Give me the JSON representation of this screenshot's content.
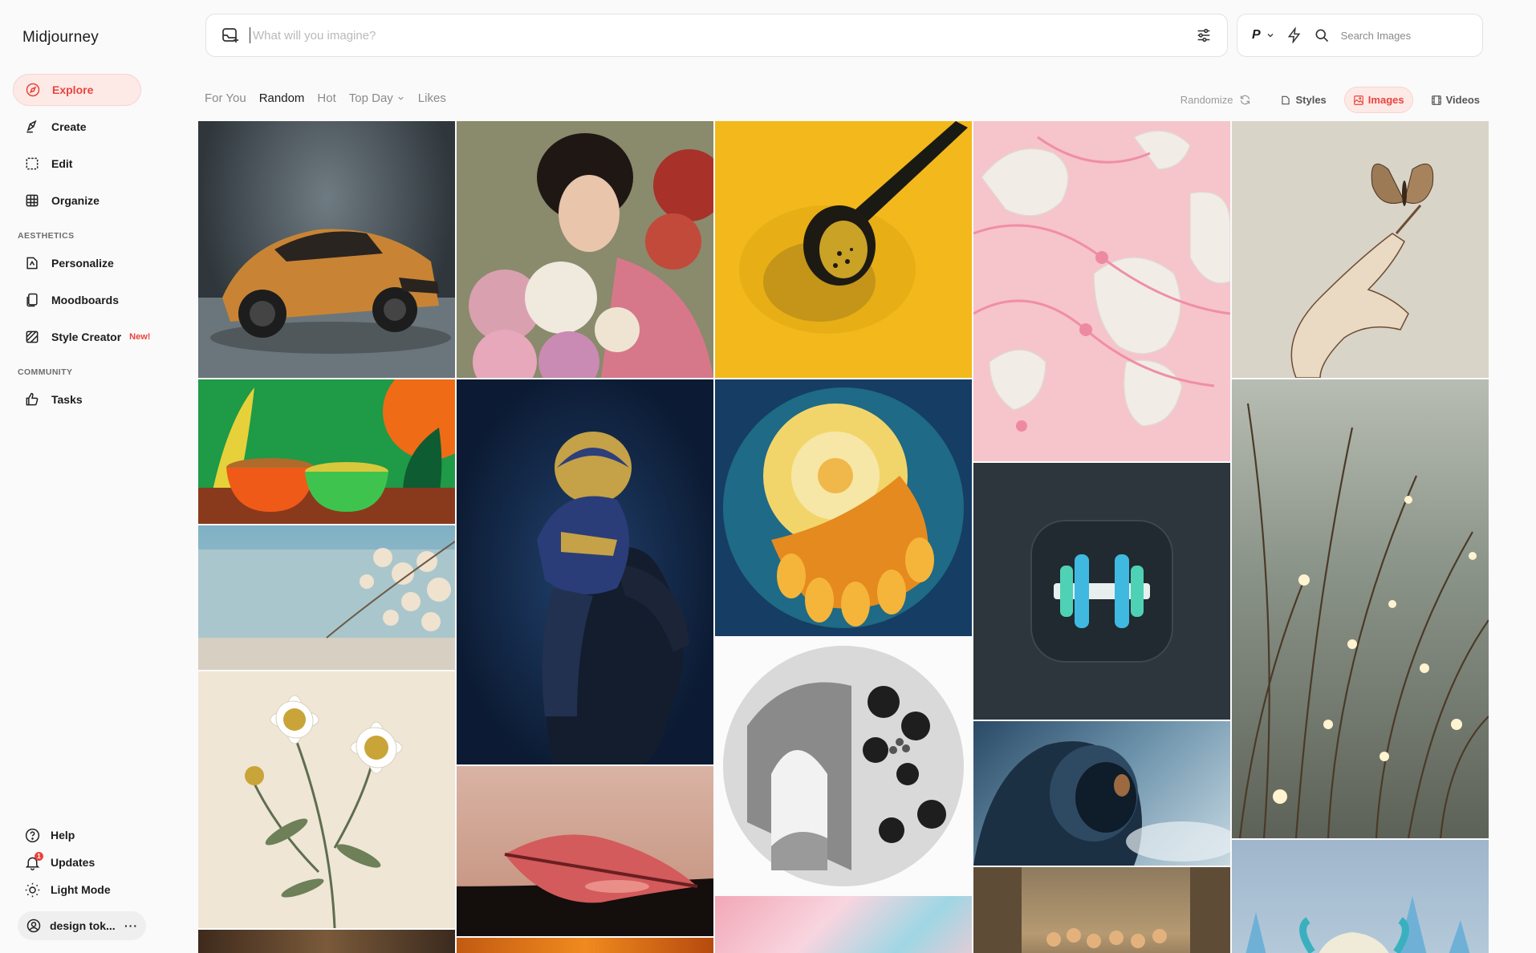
{
  "sidebar": {
    "brand": "Midjourney",
    "nav": [
      {
        "label": "Explore",
        "icon": "compass-icon"
      },
      {
        "label": "Create",
        "icon": "brush-icon"
      },
      {
        "label": "Edit",
        "icon": "edit-icon"
      },
      {
        "label": "Organize",
        "icon": "grid-icon"
      }
    ],
    "aesthetics_title": "AESTHETICS",
    "aesthetics": [
      {
        "label": "Personalize",
        "icon": "personalize-icon"
      },
      {
        "label": "Moodboards",
        "icon": "moodboard-icon"
      },
      {
        "label": "Style Creator",
        "icon": "style-creator-icon",
        "badge": "New!"
      }
    ],
    "community_title": "COMMUNITY",
    "community": [
      {
        "label": "Tasks",
        "icon": "thumbs-up-icon"
      }
    ],
    "bottom": [
      {
        "label": "Help",
        "icon": "help-icon"
      },
      {
        "label": "Updates",
        "icon": "bell-icon",
        "badge": "1"
      },
      {
        "label": "Light Mode",
        "icon": "sun-icon"
      }
    ],
    "user": "design tok..."
  },
  "prompt": {
    "placeholder": "What will you imagine?"
  },
  "search": {
    "mode": "P",
    "placeholder": "Search Images"
  },
  "filters": [
    "For You",
    "Random",
    "Hot",
    "Top Day",
    "Likes"
  ],
  "active_filter": "Random",
  "controls": {
    "randomize": "Randomize",
    "styles": "Styles",
    "images": "Images",
    "videos": "Videos"
  },
  "colors": {
    "accent": "#e8453c",
    "accent_bg": "#fde9e6"
  }
}
